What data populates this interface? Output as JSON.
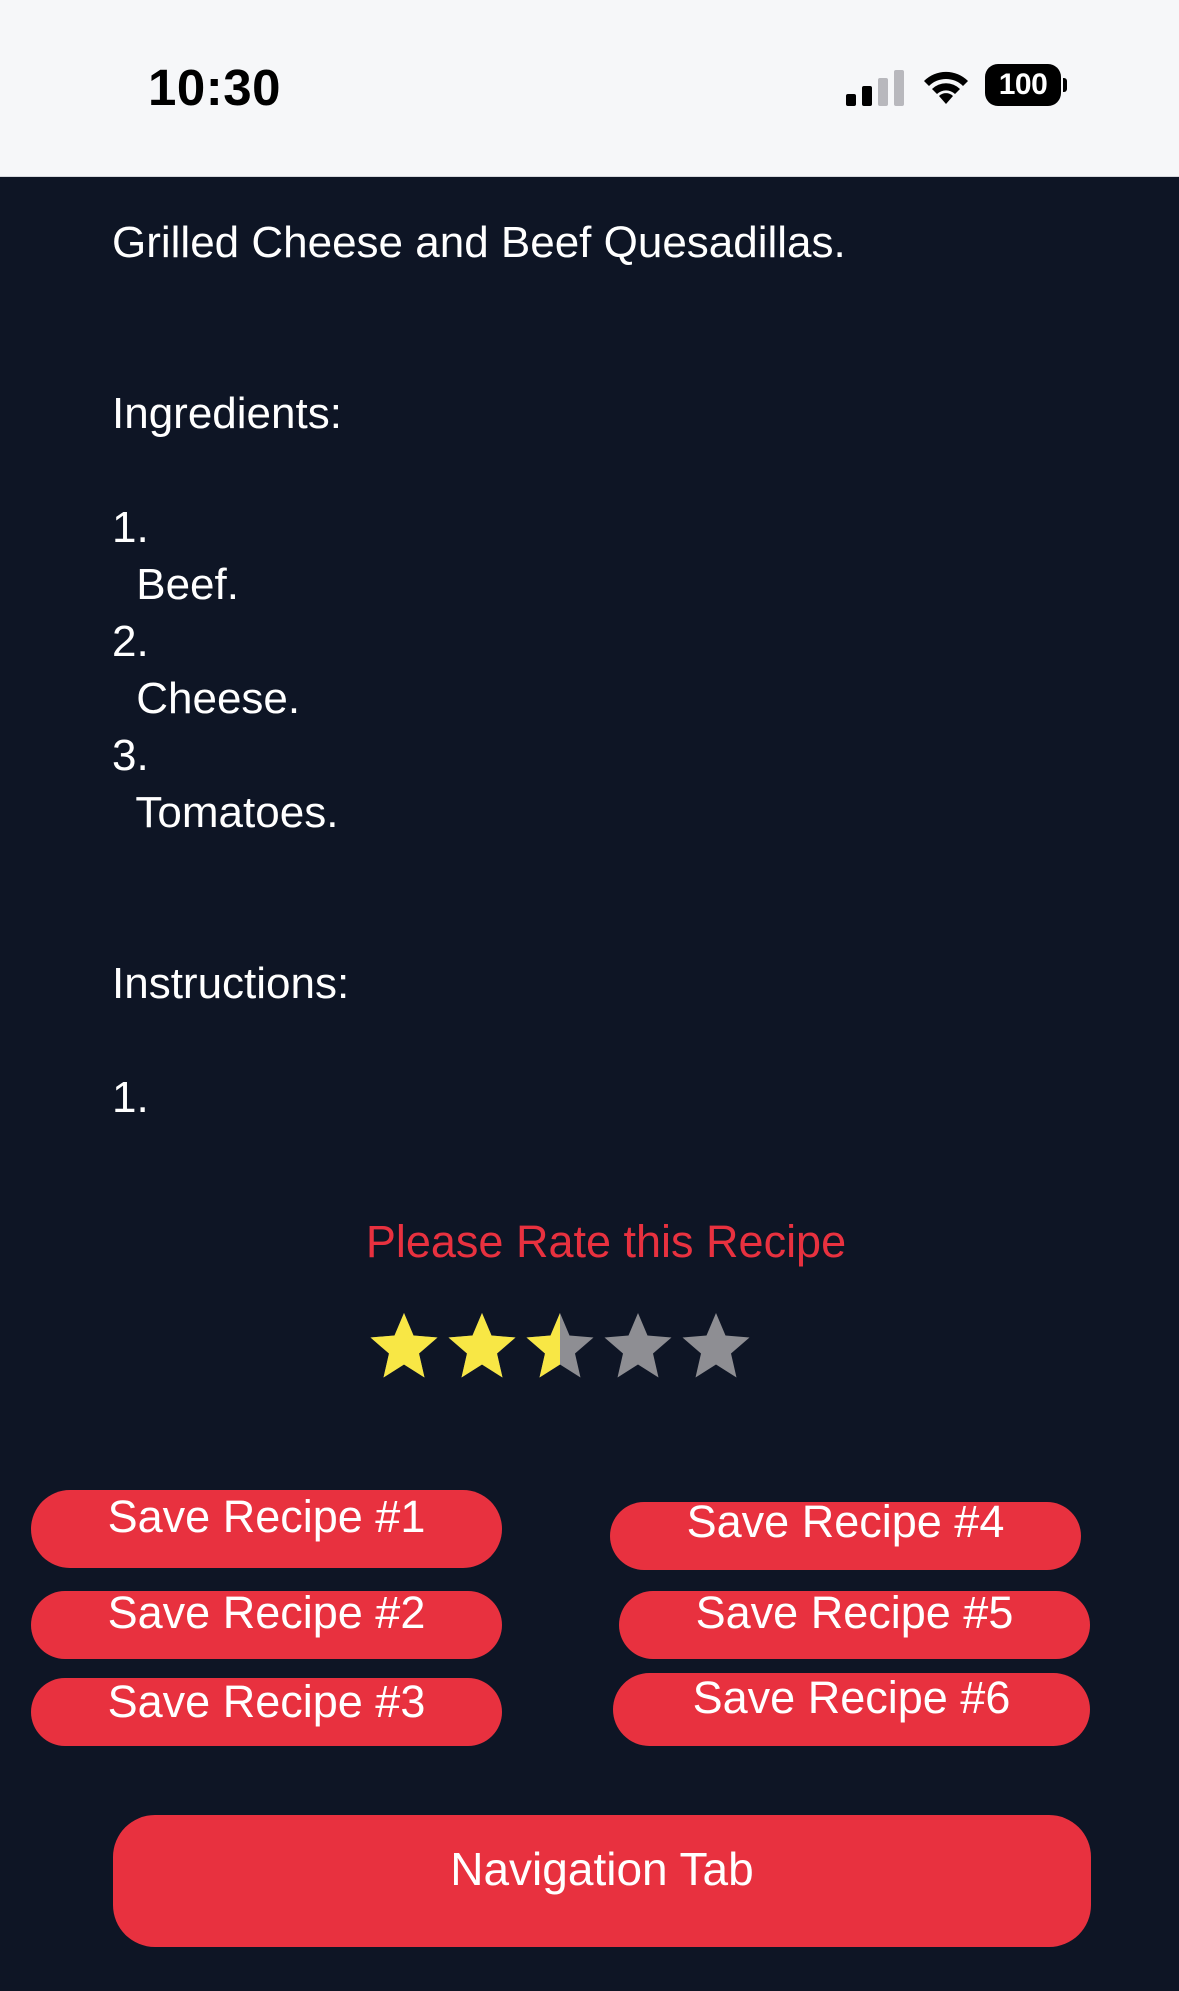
{
  "status_bar": {
    "time": "10:30",
    "battery": "100",
    "icons": [
      "signal-icon",
      "wifi-icon",
      "battery-icon"
    ]
  },
  "recipe": {
    "title": "Grilled Cheese and Beef Quesadillas.",
    "ingredients_heading": "Ingredients:",
    "ingredients": [
      {
        "number": "1.",
        "text": " Beef."
      },
      {
        "number": "2.",
        "text": " Cheese."
      },
      {
        "number": "3.",
        "text": " Tomatoes."
      }
    ],
    "instructions_heading": "Instructions:",
    "instructions": [
      {
        "number": "1.",
        "text": ""
      }
    ]
  },
  "rating": {
    "prompt": "Please Rate this Recipe",
    "value": 2.5,
    "max": 5,
    "filled_color": "#f8e745",
    "empty_color": "#8e8e93"
  },
  "save_buttons": {
    "b1": "Save Recipe #1",
    "b2": "Save Recipe #2",
    "b3": "Save Recipe #3",
    "b4": "Save Recipe #4",
    "b5": "Save Recipe #5",
    "b6": "Save Recipe #6"
  },
  "navigation": {
    "label": "Navigation Tab"
  },
  "colors": {
    "background": "#0e1525",
    "accent": "#e8313f",
    "status_bar": "#f6f7f9"
  }
}
